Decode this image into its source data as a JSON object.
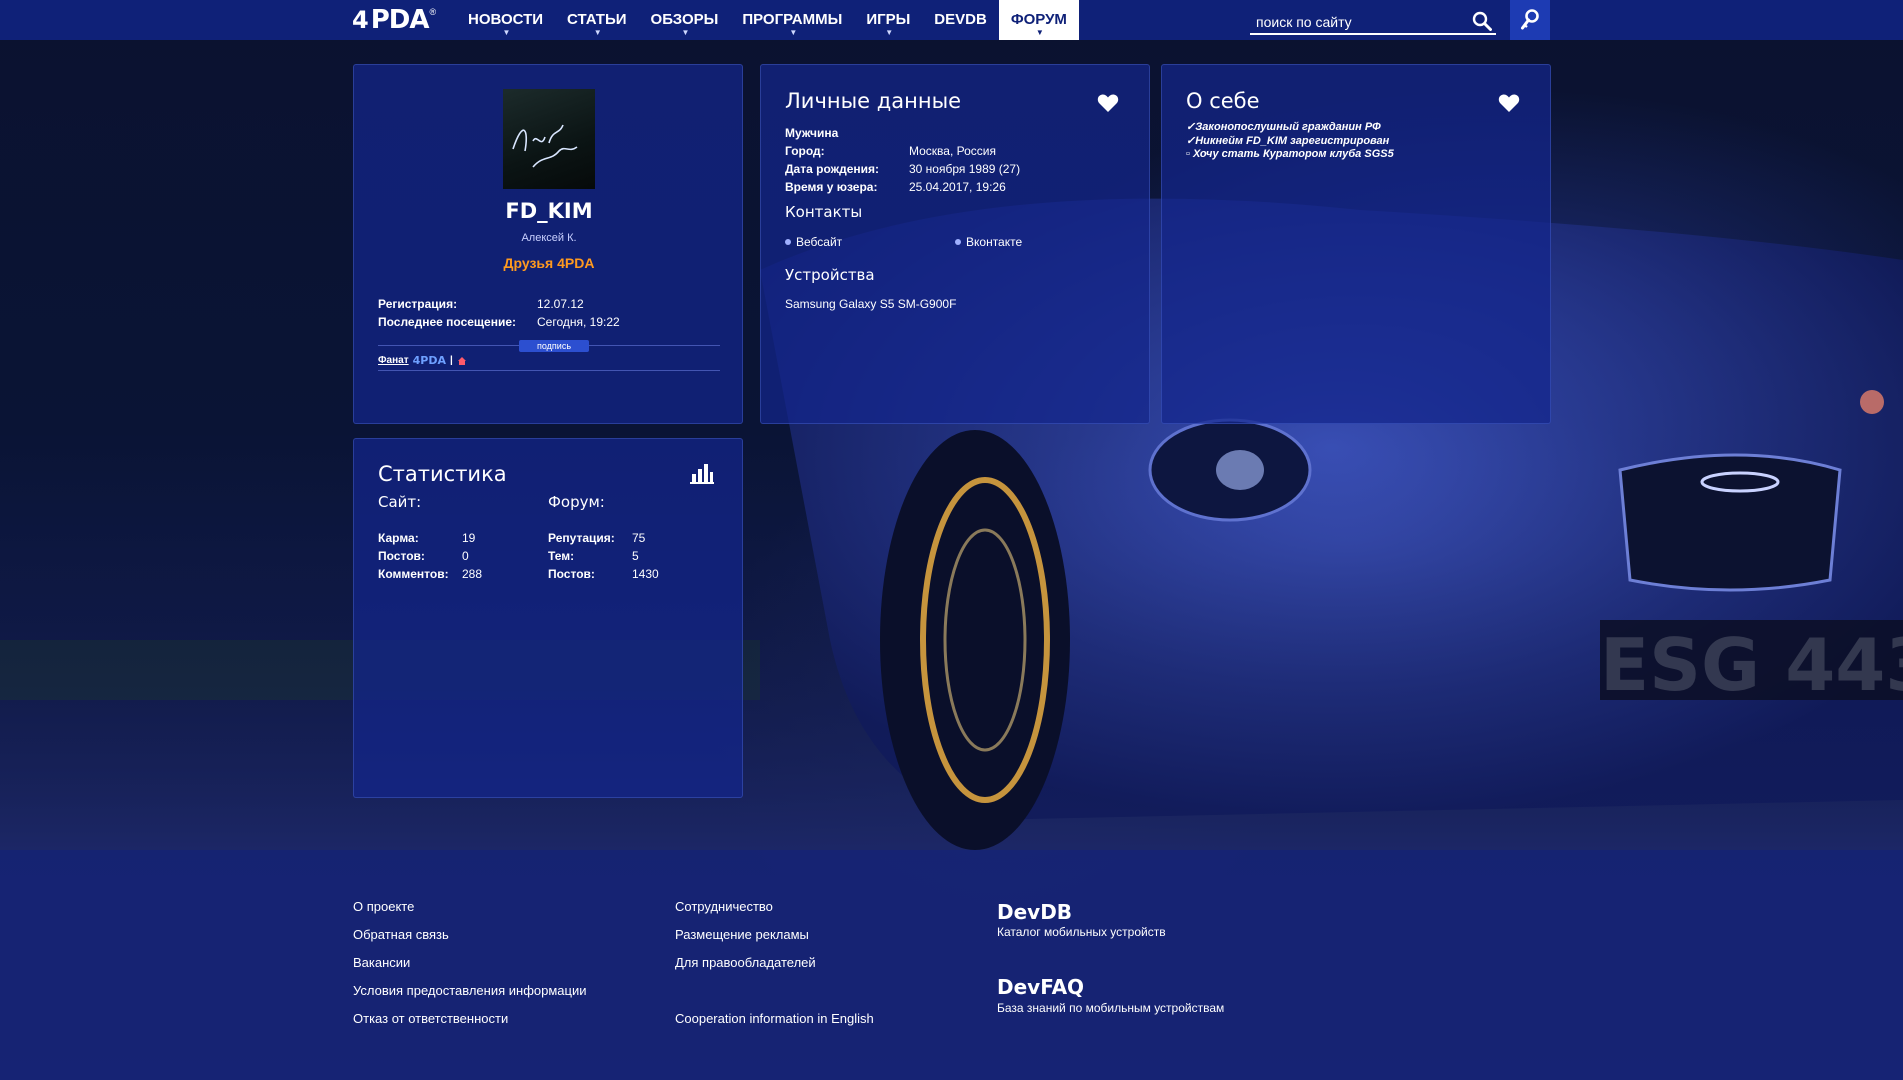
{
  "header": {
    "logo_prefix": "4",
    "logo_text": "PDA",
    "logo_mark": "®",
    "nav": [
      {
        "label": "НОВОСТИ",
        "has_dropdown": true
      },
      {
        "label": "СТАТЬИ",
        "has_dropdown": true
      },
      {
        "label": "ОБЗОРЫ",
        "has_dropdown": true
      },
      {
        "label": "ПРОГРАММЫ",
        "has_dropdown": true
      },
      {
        "label": "ИГРЫ",
        "has_dropdown": true
      },
      {
        "label": "DEVDB",
        "has_dropdown": false
      },
      {
        "label": "ФОРУМ",
        "has_dropdown": true,
        "active": true
      }
    ],
    "search_placeholder": "поиск по сайту",
    "icons": {
      "search": "search-icon",
      "login": "key-icon"
    }
  },
  "profile": {
    "avatar_text": "Just Live..13",
    "username": "FD_KIM",
    "real_name": "Алексей К.",
    "group": "Друзья 4PDA",
    "group_color": "#ff9a1f",
    "registration_label": "Регистрация:",
    "registration_value": "12.07.12",
    "last_visit_label": "Последнее посещение:",
    "last_visit_value": "Сегодня, 19:22",
    "signature_badge": "подпись",
    "signature_fan": "Фанат",
    "signature_logo": "4PDA",
    "signature_sep": "|"
  },
  "personal": {
    "title": "Личные данные",
    "gender": "Мужчина",
    "city_label": "Город:",
    "city_value": "Москва, Россия",
    "birth_label": "Дата рождения:",
    "birth_value": "30 ноября 1989 (27)",
    "time_label": "Время у юзера:",
    "time_value": "25.04.2017, 19:26",
    "contacts_title": "Контакты",
    "contact_website": "Вебсайт",
    "contact_vk": "Вконтакте",
    "devices_title": "Устройства",
    "device": "Samsung Galaxy S5 SM-G900F"
  },
  "about": {
    "title": "О себе",
    "lines": [
      "✓Законопослушный гражданин РФ",
      "✓Никнейм FD_KIM зарегистрирован",
      "▫ Хочу стать Куратором клуба SGS5"
    ]
  },
  "stats": {
    "title": "Статистика",
    "site_title": "Сайт:",
    "forum_title": "Форум:",
    "site": [
      {
        "k": "Карма:",
        "v": "19"
      },
      {
        "k": "Постов:",
        "v": "0"
      },
      {
        "k": "Комментов:",
        "v": "288"
      }
    ],
    "forum": [
      {
        "k": "Репутация:",
        "v": "75"
      },
      {
        "k": "Тем:",
        "v": "5"
      },
      {
        "k": "Постов:",
        "v": "1430"
      }
    ]
  },
  "footer": {
    "col1": [
      "О проекте",
      "Обратная связь",
      "Вакансии",
      "Условия предоставления информации",
      "Отказ от ответственности"
    ],
    "col2": [
      "Сотрудничество",
      "Размещение рекламы",
      "Для правообладателей",
      "Cooperation information in English"
    ],
    "devdb_title": "DevDB",
    "devdb_desc": "Каталог мобильных устройств",
    "devfaq_title": "DevFAQ",
    "devfaq_desc": "База знаний по мобильным устройствам"
  },
  "colors": {
    "topbar": "#0f2178",
    "accent": "#1d3bb3",
    "panel": "#14258c"
  }
}
